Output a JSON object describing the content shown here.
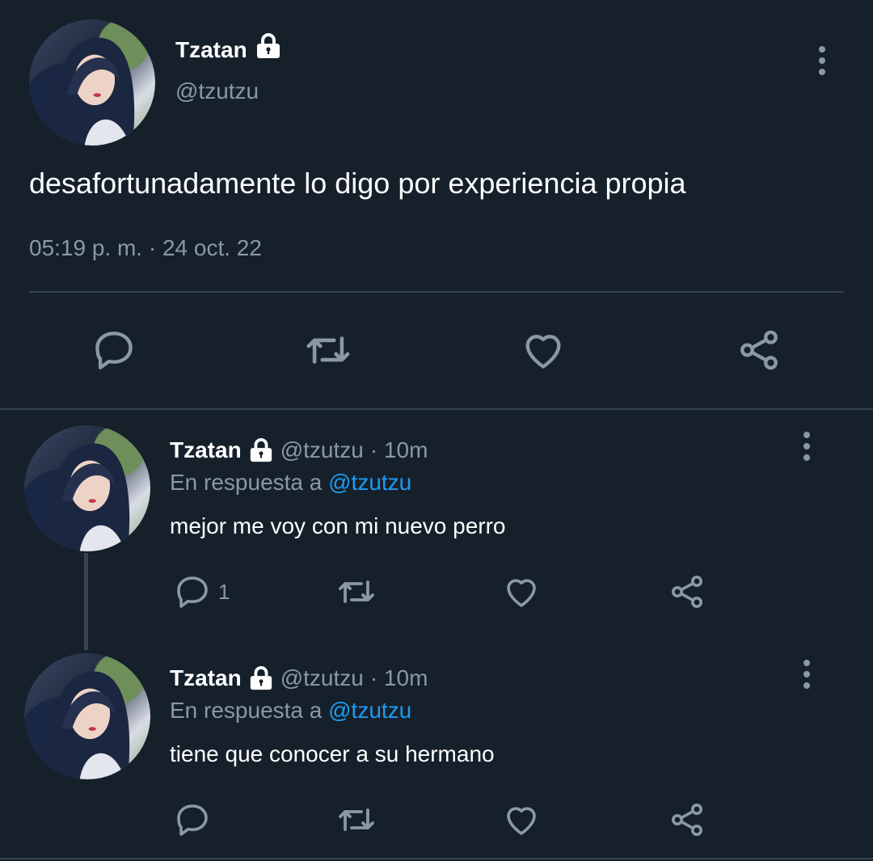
{
  "main_tweet": {
    "display_name": "Tzatan",
    "handle": "@tzutzu",
    "text": "desafortunadamente lo digo por experiencia propia",
    "timestamp": "05:19 p. m. · 24 oct. 22"
  },
  "replies": [
    {
      "display_name": "Tzatan",
      "handle": "@tzutzu",
      "time": "· 10m",
      "reply_prefix": "En respuesta a",
      "reply_to": "@tzutzu",
      "text": "mejor me voy con mi nuevo perro",
      "reply_count": "1"
    },
    {
      "display_name": "Tzatan",
      "handle": "@tzutzu",
      "time": "· 10m",
      "reply_prefix": "En respuesta a",
      "reply_to": "@tzutzu",
      "text": "tiene que conocer a su hermano",
      "reply_count": ""
    }
  ],
  "icons": [
    "lock-icon",
    "more-options-icon",
    "reply-icon",
    "retweet-icon",
    "like-icon",
    "share-icon"
  ],
  "colors": {
    "background": "#15202b",
    "accent": "#1d9bf0",
    "muted": "#8b98a5",
    "divider": "#38444d"
  }
}
